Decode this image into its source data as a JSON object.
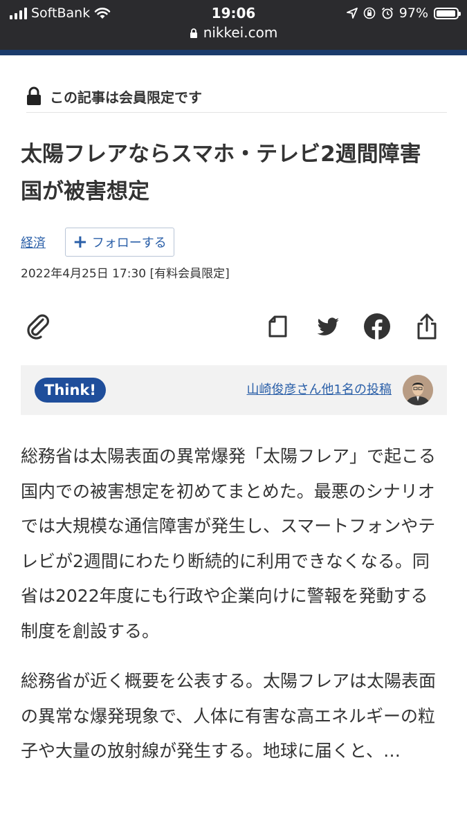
{
  "status_bar": {
    "carrier": "SoftBank",
    "time": "19:06",
    "battery": "97%",
    "battery_level": 0.97,
    "icons": [
      "signal-icon",
      "wifi-icon",
      "location-icon",
      "orientation-lock-icon",
      "alarm-icon",
      "battery-icon"
    ]
  },
  "browser": {
    "url": "nikkei.com",
    "icons": [
      "lock-icon"
    ]
  },
  "article": {
    "member_notice": "この記事は会員限定です",
    "headline": "太陽フレアならスマホ・テレビ2週間障害　国が被害想定",
    "category": "経済",
    "follow_label": "フォローする",
    "date": "2022年4月25日 17:30 [有料会員限定]",
    "share_icons": [
      "paperclip-icon",
      "save-page-icon",
      "twitter-icon",
      "facebook-icon",
      "share-icon"
    ],
    "think": {
      "badge": "Think!",
      "link": "山崎俊彦さん他1名の投稿"
    },
    "paragraphs": [
      "総務省は太陽表面の異常爆発「太陽フレア」で起こる国内での被害想定を初めてまとめた。最悪のシナリオでは大規模な通信障害が発生し、スマートフォンやテレビが2週間にわたり断続的に利用できなくなる。同省は2022年度にも行政や企業向けに警報を発動する制度を創設する。",
      "総務省が近く概要を公表する。太陽フレアは太陽表面の異常な爆発現象で、人体に有害な高エネルギーの粒子や大量の放射線が発生する。地球に届くと、…"
    ]
  },
  "colors": {
    "topbar": "#2b2b2e",
    "accent": "#1b3b6b",
    "link": "#2a5fa8",
    "think_badge": "#1f4e9b",
    "think_bar": "#f2f2f2",
    "text": "#333333"
  }
}
